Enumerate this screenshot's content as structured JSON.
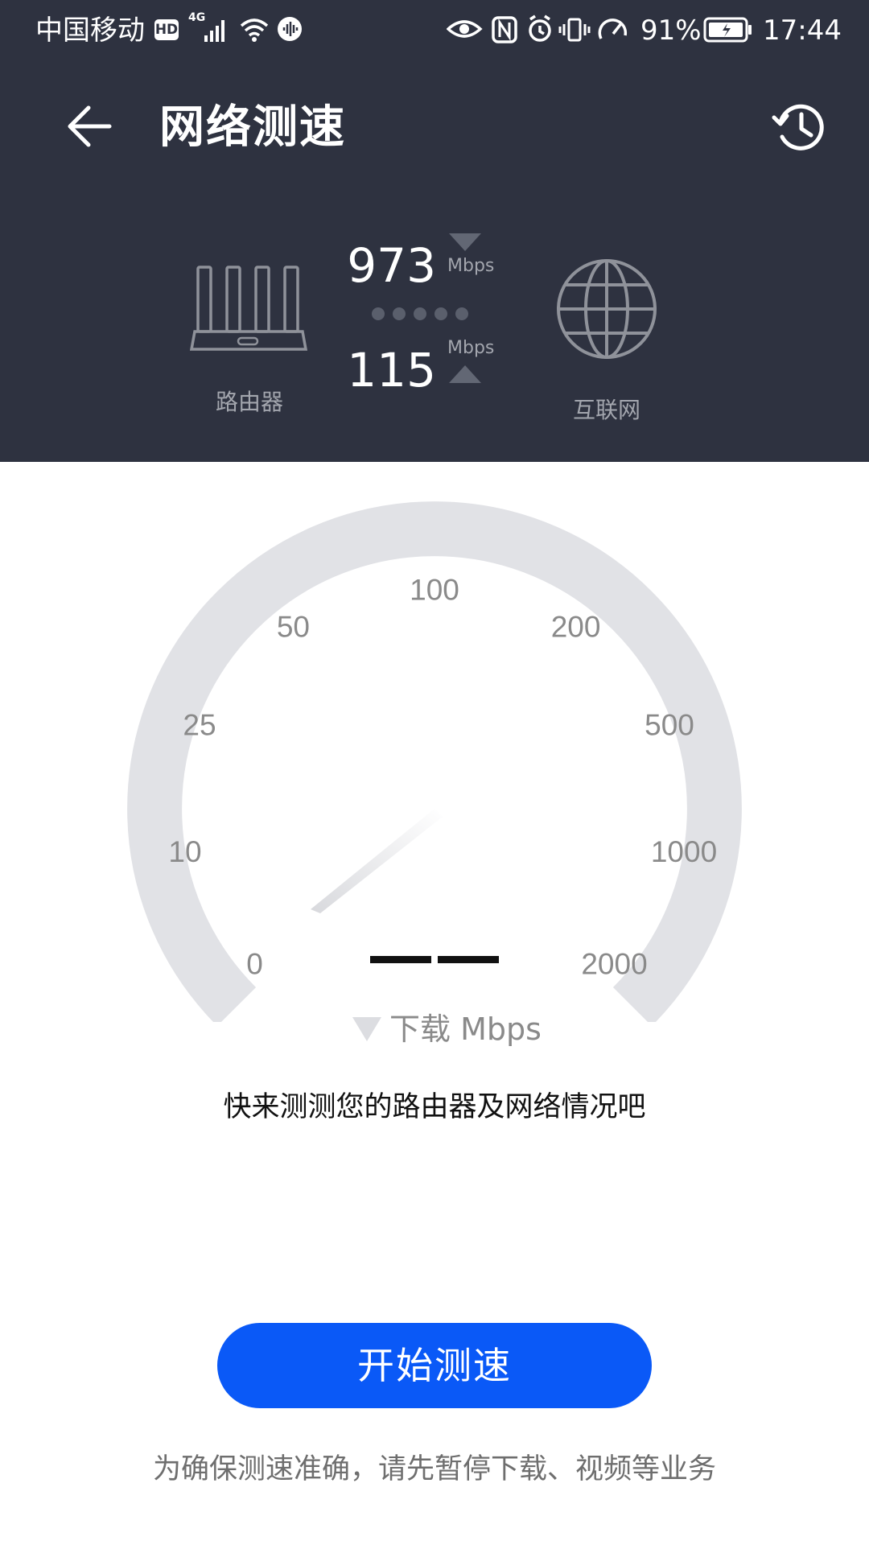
{
  "status_bar": {
    "carrier": "中国移动",
    "hd_badge": "HD",
    "network_type": "4G",
    "battery_percent": "91%",
    "time": "17:44",
    "icons": [
      "hd-icon",
      "signal-icon",
      "wifi-icon",
      "audio-icon",
      "eye-icon",
      "nfc-icon",
      "alarm-icon",
      "vibrate-icon",
      "speedometer-icon",
      "battery-icon"
    ]
  },
  "header": {
    "title": "网络测速",
    "back_icon": "back-arrow-icon",
    "history_icon": "history-icon"
  },
  "connection": {
    "router_label": "路由器",
    "internet_label": "互联网",
    "download_value": "973",
    "download_unit": "Mbps",
    "upload_value": "115",
    "upload_unit": "Mbps"
  },
  "gauge": {
    "scale_labels": [
      "0",
      "10",
      "25",
      "50",
      "100",
      "200",
      "500",
      "1000",
      "2000"
    ],
    "current_reading": "— —",
    "unit_label": "下载 Mbps"
  },
  "hint_text": "快来测测您的路由器及网络情况吧",
  "start_button": "开始测速",
  "footnote": "为确保测速准确，请先暂停下载、视频等业务",
  "colors": {
    "header_bg": "#2e3240",
    "accent_blue": "#0a59f7",
    "gauge_track": "#e1e2e6"
  }
}
